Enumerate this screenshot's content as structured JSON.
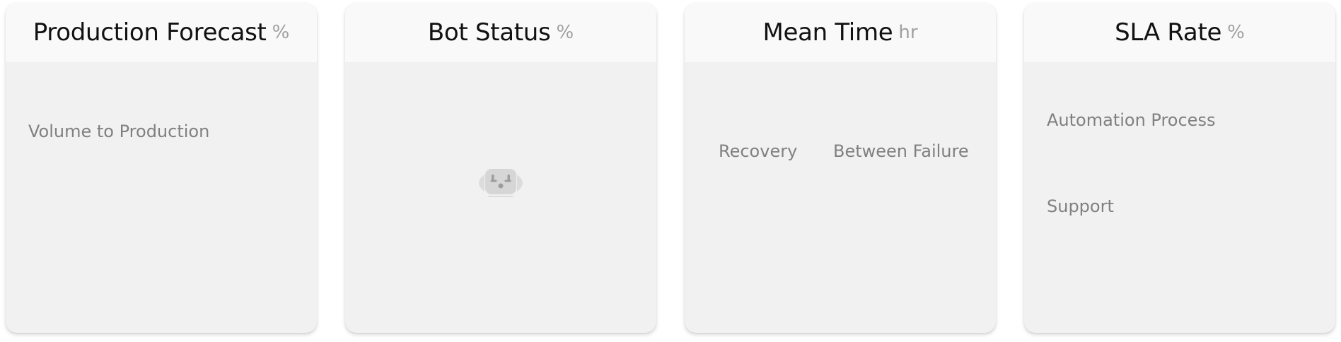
{
  "cards": [
    {
      "title": "Production Forecast",
      "unit": "%",
      "labels": [
        "Volume to Production"
      ]
    },
    {
      "title": "Bot Status",
      "unit": "%",
      "icon": "robot-icon"
    },
    {
      "title": "Mean Time",
      "unit": "hr",
      "labels": [
        "Recovery",
        "Between Failure"
      ]
    },
    {
      "title": "SLA Rate",
      "unit": "%",
      "labels": [
        "Automation Process",
        "Support"
      ]
    }
  ],
  "colors": {
    "card_bg": "#f1f1f1",
    "header_bg": "#f9f9f9",
    "title": "#111111",
    "unit": "#a0a0a0",
    "label": "#808080",
    "icon": "#d4d4d4"
  }
}
